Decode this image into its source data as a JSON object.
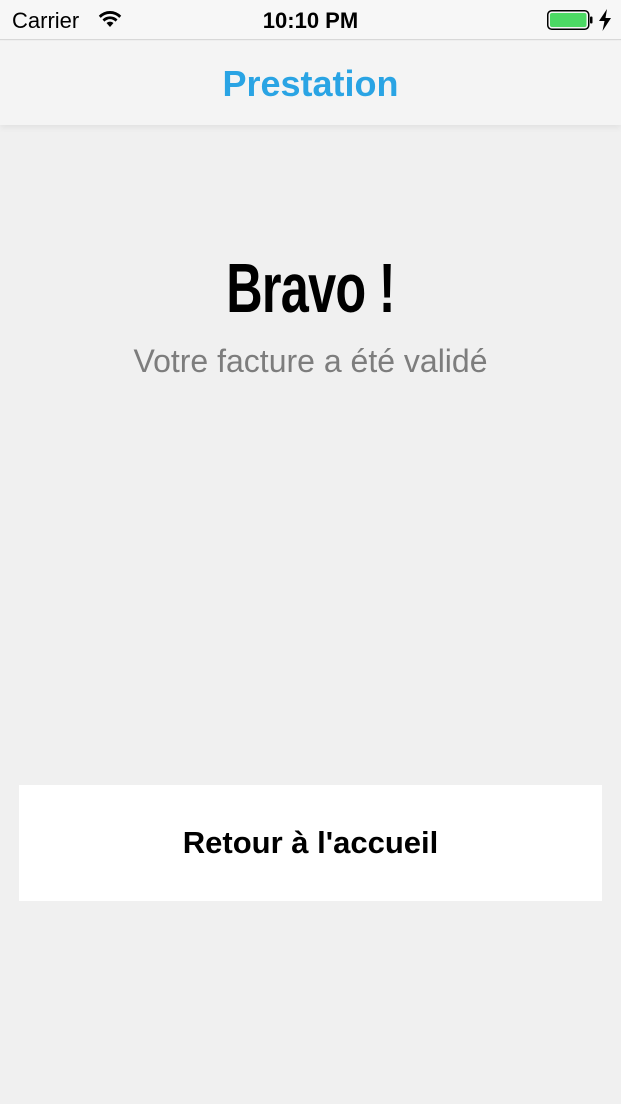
{
  "status_bar": {
    "carrier": "Carrier",
    "time": "10:10 PM",
    "wifi_icon": "wifi-icon",
    "battery_icon": "battery-icon",
    "charging_icon": "bolt-icon",
    "battery_color": "#4cd964"
  },
  "nav": {
    "title": "Prestation",
    "title_color": "#2aa4e4"
  },
  "content": {
    "headline": "Bravo !",
    "subtitle": "Votre facture a été validé"
  },
  "actions": {
    "home_button_label": "Retour à l'accueil"
  }
}
